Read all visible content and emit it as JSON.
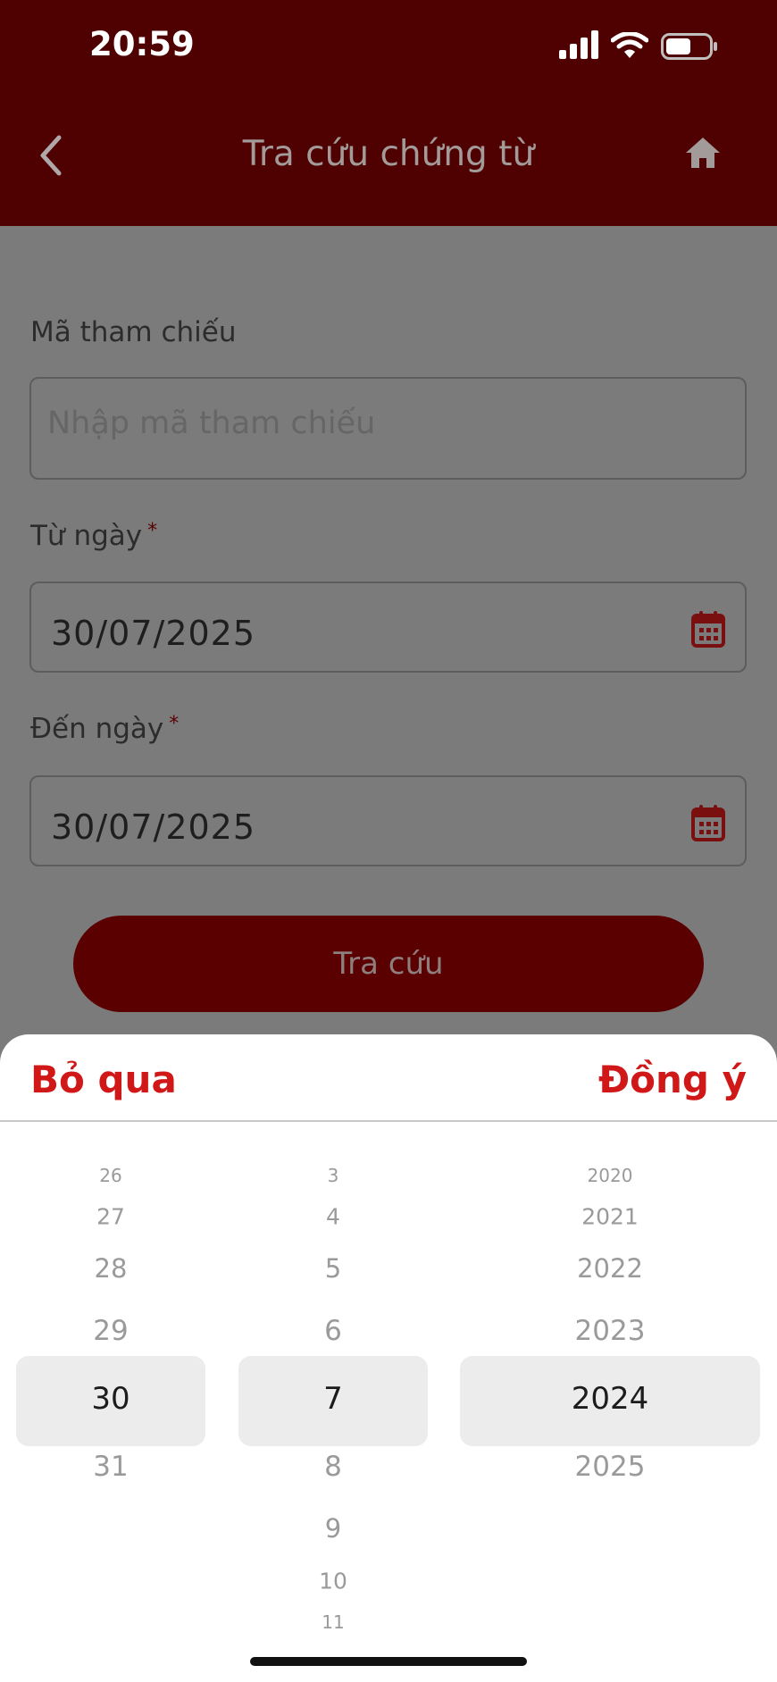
{
  "status_bar": {
    "time": "20:59"
  },
  "header": {
    "title": "Tra cứu chứng từ"
  },
  "form": {
    "reference": {
      "label": "Mã tham chiếu",
      "placeholder": "Nhập mã tham chiếu"
    },
    "from_date": {
      "label": "Từ ngày",
      "required": "*",
      "value": "30/07/2025"
    },
    "to_date": {
      "label": "Đến ngày",
      "required": "*",
      "value": "30/07/2025"
    },
    "search_button": "Tra cứu"
  },
  "picker": {
    "cancel_label": "Bỏ qua",
    "confirm_label": "Đồng ý",
    "days": [
      "26",
      "27",
      "28",
      "29",
      "30",
      "31"
    ],
    "months": [
      "3",
      "4",
      "5",
      "6",
      "7",
      "8",
      "9",
      "10",
      "11"
    ],
    "years": [
      "2020",
      "2021",
      "2022",
      "2023",
      "2024",
      "2025"
    ],
    "selected": {
      "day": "30",
      "month": "7",
      "year": "2024"
    }
  },
  "colors": {
    "brand": "#4f0000",
    "button": "#5a0000",
    "accent": "#d01818"
  },
  "icons": [
    "back-chevron-icon",
    "home-icon",
    "calendar-icon",
    "signal-icon",
    "wifi-icon",
    "battery-icon"
  ]
}
